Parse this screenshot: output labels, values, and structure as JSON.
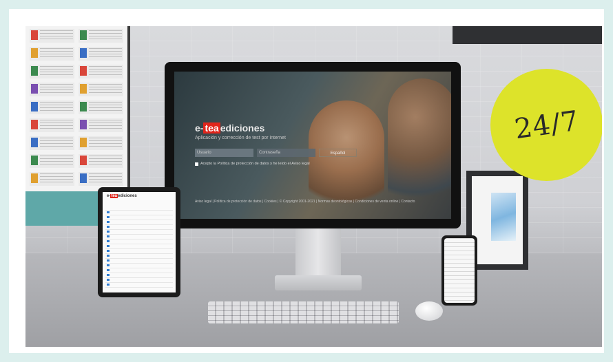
{
  "badge": {
    "text": "24/7",
    "color": "#dde32a"
  },
  "monitor": {
    "logo_prefix": "e-",
    "logo_highlight": "tea",
    "logo_suffix": "ediciones",
    "subtitle": "Aplicación y corrección de test por internet",
    "username_placeholder": "Usuario",
    "password_placeholder": "Contraseña",
    "language": "Español",
    "accept_text": "Acepto la Política de protección de datos y he leído el Aviso legal",
    "footer_links": "Aviso legal | Política de protección de datos | Cookies | © Copyright 2001-2021 | Normas deontológicas | Condiciones de venta online | Contacto"
  },
  "tablet": {
    "logo_prefix": "e-",
    "logo_highlight": "tea",
    "logo_suffix": "ediciones"
  },
  "colors": {
    "brand_red": "#e1251b",
    "background": "#dcefed"
  }
}
